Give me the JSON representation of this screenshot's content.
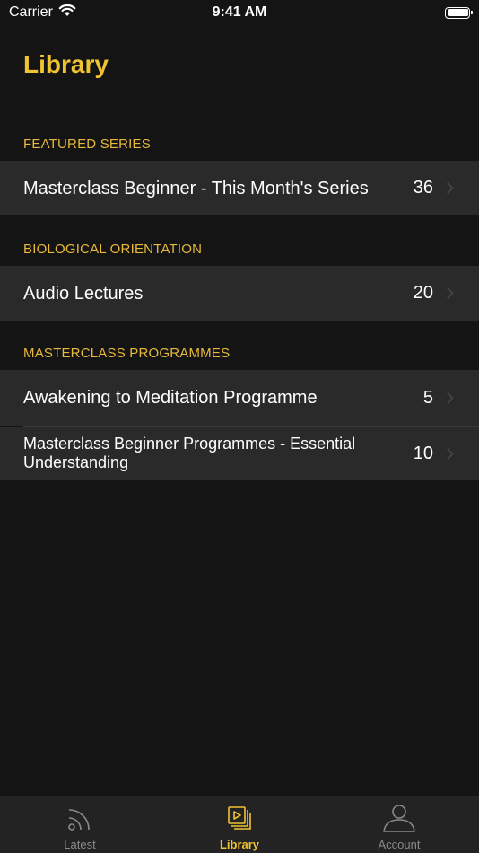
{
  "status_bar": {
    "carrier": "Carrier",
    "time": "9:41 AM"
  },
  "page_title": "Library",
  "sections": [
    {
      "header": "FEATURED SERIES",
      "rows": [
        {
          "label": "Masterclass Beginner - This Month's Series",
          "count": "36"
        }
      ]
    },
    {
      "header": "BIOLOGICAL ORIENTATION",
      "rows": [
        {
          "label": "Audio Lectures",
          "count": "20"
        }
      ]
    },
    {
      "header": "MASTERCLASS PROGRAMMES",
      "rows": [
        {
          "label": "Awakening to Meditation Programme",
          "count": "5"
        },
        {
          "label": "Masterclass Beginner Programmes - Essential Understanding",
          "count": "10"
        }
      ]
    }
  ],
  "tab_bar": {
    "tabs": [
      {
        "label": "Latest",
        "icon": "rss-icon"
      },
      {
        "label": "Library",
        "icon": "library-icon",
        "active": true
      },
      {
        "label": "Account",
        "icon": "person-icon"
      }
    ]
  },
  "colors": {
    "accent": "#f0c330",
    "background": "#141414",
    "row": "#2a2a2a"
  }
}
